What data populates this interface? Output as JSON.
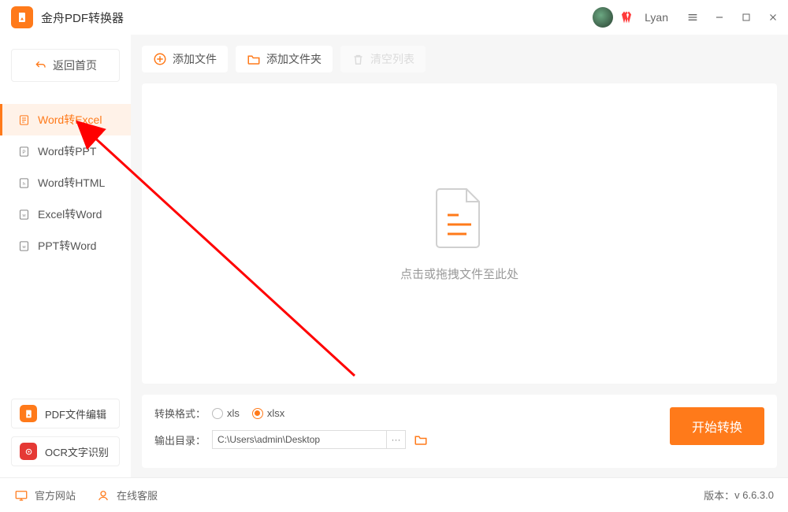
{
  "app": {
    "title": "金舟PDF转换器",
    "username": "Lyan"
  },
  "sidebar": {
    "back_label": "返回首页",
    "items": [
      {
        "label": "Word转Excel"
      },
      {
        "label": "Word转PPT"
      },
      {
        "label": "Word转HTML"
      },
      {
        "label": "Excel转Word"
      },
      {
        "label": "PPT转Word"
      }
    ],
    "tool_pdf_edit": "PDF文件编辑",
    "tool_ocr": "OCR文字识别"
  },
  "toolbar": {
    "add_file": "添加文件",
    "add_folder": "添加文件夹",
    "clear_list": "清空列表"
  },
  "drop": {
    "hint": "点击或拖拽文件至此处"
  },
  "bottom": {
    "format_label": "转换格式：",
    "opt_xls": "xls",
    "opt_xlsx": "xlsx",
    "output_label": "输出目录：",
    "output_path": "C:\\Users\\admin\\Desktop",
    "more": "···",
    "convert": "开始转换"
  },
  "footer": {
    "official_site": "官方网站",
    "live_support": "在线客服",
    "version_label": "版本：",
    "version_value": "v 6.6.3.0"
  }
}
